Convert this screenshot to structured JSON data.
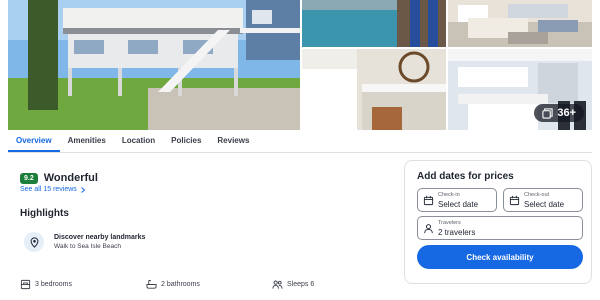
{
  "gallery": {
    "photo_count": "36+"
  },
  "tabs": [
    {
      "label": "Overview",
      "active": true
    },
    {
      "label": "Amenities"
    },
    {
      "label": "Location"
    },
    {
      "label": "Policies"
    },
    {
      "label": "Reviews"
    }
  ],
  "rating": {
    "score": "9.2",
    "word": "Wonderful",
    "reviews_link": "See all 15 reviews"
  },
  "highlights": {
    "title": "Highlights",
    "landmark_title": "Discover nearby landmarks",
    "landmark_sub": "Walk to Sea Isle Beach"
  },
  "amenities": {
    "bedrooms": "3 bedrooms",
    "bathrooms": "2 bathrooms",
    "sleeps": "Sleeps 6"
  },
  "booking": {
    "title": "Add dates for prices",
    "checkin_label": "Check-in",
    "checkin_value": "Select date",
    "checkout_label": "Check-out",
    "checkout_value": "Select date",
    "travelers_label": "Travelers",
    "travelers_value": "2 travelers",
    "button_label": "Check availability"
  },
  "colors": {
    "accent": "#1668e3",
    "rating_green": "#1b7e3a"
  }
}
